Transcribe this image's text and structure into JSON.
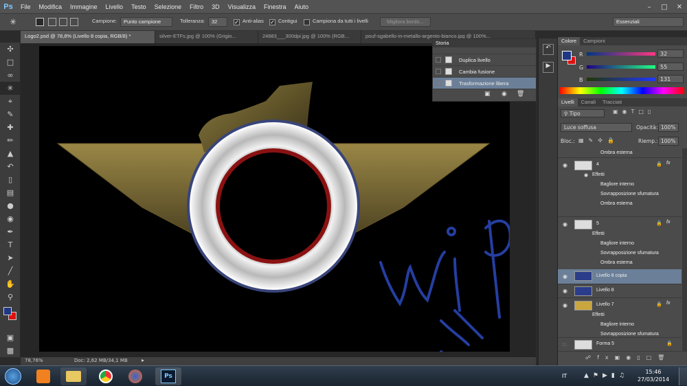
{
  "app": {
    "logo": "Ps",
    "menu": [
      "File",
      "Modifica",
      "Immagine",
      "Livello",
      "Testo",
      "Selezione",
      "Filtro",
      "3D",
      "Visualizza",
      "Finestra",
      "Aiuto"
    ]
  },
  "options": {
    "campione_label": "Campione:",
    "campione_value": "Punto campione",
    "tolleranza_label": "Tolleranza:",
    "tolleranza_value": "32",
    "antialias": "Anti-alias",
    "contigui": "Contigui",
    "campiona_tutti": "Campiona da tutti i livelli",
    "migliora": "Migliora bordo...",
    "workspace": "Essenziali"
  },
  "tabs": [
    "Logo2.psd @ 78,8% (Livello 8 copia, RGB/8) *",
    "silver-ETFs.jpg @ 100% (Grigio...",
    "24883___300dpi.jpg @ 100% (RGB...",
    "pouf-sgabello-in-metallo-argento-bianco.jpg @ 100%..."
  ],
  "status": {
    "zoom": "78,76%",
    "doc": "Doc: 2,62 MB/34,1 MB"
  },
  "storia": {
    "title": "Storia",
    "items": [
      "Duplica livello",
      "Cambia fusione",
      "Trasformazione libera"
    ]
  },
  "colore": {
    "tabs": [
      "Colore",
      "Campioni"
    ],
    "r_label": "R",
    "r": "32",
    "g_label": "G",
    "g": "55",
    "b_label": "B",
    "b": "131",
    "fg": "#203783",
    "bg": "#e01010"
  },
  "livelli": {
    "tabs": [
      "Livelli",
      "Canali",
      "Tracciati"
    ],
    "filter": "Tipo",
    "blend": "Luce soffusa",
    "opacity_label": "Opacità:",
    "opacity": "100%",
    "lock_label": "Bloc.:",
    "fill_label": "Riemp.:",
    "fill": "100%",
    "top_effect": "Ombra esterna",
    "layers": [
      {
        "name": "4",
        "effects_label": "Effetti",
        "effects": [
          "Bagliore interno",
          "Sovrapposizione sfumatura",
          "Ombra esterna"
        ]
      },
      {
        "name": "5",
        "effects_label": "Effetti",
        "effects": [
          "Bagliore interno",
          "Sovrapposizione sfumatura",
          "Ombra esterna"
        ]
      },
      {
        "name": "Livello 8 copia"
      },
      {
        "name": "Livello 8"
      },
      {
        "name": "Livello 7",
        "effects_label": "Effetti",
        "effects": [
          "Bagliore interno",
          "Sovrapposizione sfumatura"
        ]
      },
      {
        "name": "Forma 5"
      }
    ]
  },
  "taskbar": {
    "lang": "IT",
    "time": "15:46",
    "date": "27/03/2014"
  },
  "canvas": {
    "overlay_text": "wip"
  }
}
